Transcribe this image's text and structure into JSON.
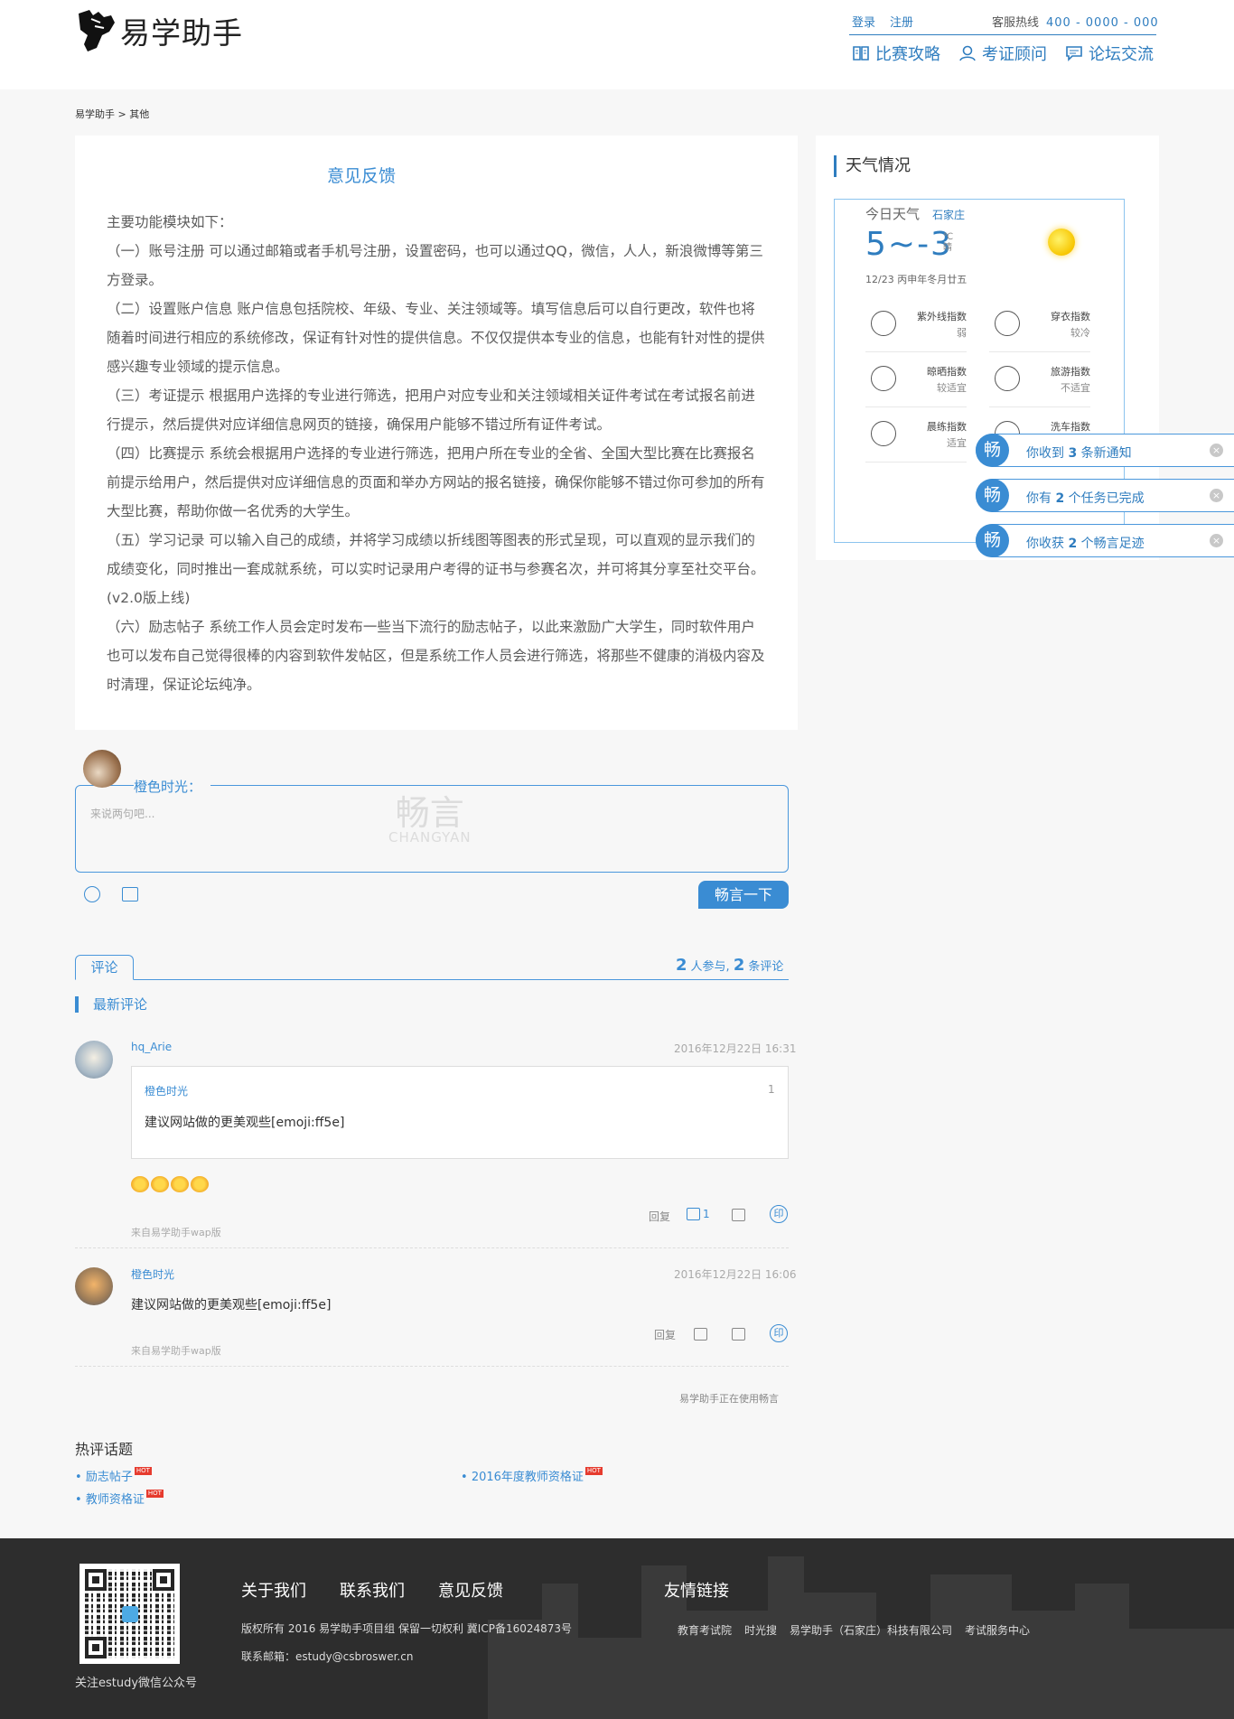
{
  "header": {
    "logo_text": "易学助手",
    "login": "登录",
    "register": "注册",
    "hotline_label": "客服热线",
    "hotline_number": "400 - 0000 - 000",
    "nav": [
      {
        "label": "比赛攻略",
        "icon": "book-icon"
      },
      {
        "label": "考证顾问",
        "icon": "user-icon"
      },
      {
        "label": "论坛交流",
        "icon": "chat-icon"
      }
    ]
  },
  "breadcrumb": {
    "home": "易学助手",
    "sep": ">",
    "current": "其他"
  },
  "article": {
    "title": "意见反馈",
    "paragraphs": [
      "主要功能模块如下：",
      "（一）账号注册 可以通过邮箱或者手机号注册，设置密码，也可以通过QQ，微信，人人，新浪微博等第三方登录。",
      "（二）设置账户信息 账户信息包括院校、年级、专业、关注领域等。填写信息后可以自行更改，软件也将随着时间进行相应的系统修改，保证有针对性的提供信息。不仅仅提供本专业的信息，也能有针对性的提供感兴趣专业领域的提示信息。",
      "（三）考证提示 根据用户选择的专业进行筛选，把用户对应专业和关注领域相关证件考试在考试报名前进行提示，然后提供对应详细信息网页的链接，确保用户能够不错过所有证件考试。",
      "（四）比赛提示 系统会根据用户选择的专业进行筛选，把用户所在专业的全省、全国大型比赛在比赛报名前提示给用户，然后提供对应详细信息的页面和举办方网站的报名链接，确保你能够不错过你可参加的所有大型比赛，帮助你做一名优秀的大学生。",
      "（五）学习记录 可以输入自己的成绩，并将学习成绩以折线图等图表的形式呈现，可以直观的显示我们的成绩变化，同时推出一套成就系统，可以实时记录用户考得的证书与参赛名次，并可将其分享至社交平台。(v2.0版上线)",
      "（六）励志帖子 系统工作人员会定时发布一些当下流行的励志帖子，以此来激励广大学生，同时软件用户也可以发布自己觉得很棒的内容到软件发帖区，但是系统工作人员会进行筛选，将那些不健康的消极内容及时清理，保证论坛纯净。"
    ]
  },
  "weather": {
    "title": "天气情况",
    "today_label": "今日天气",
    "city": "石家庄",
    "temp": "5~-3",
    "unit": "℃",
    "condition": "晴",
    "date": "12/23 丙申年冬月廿五",
    "indices": [
      {
        "name": "紫外线指数",
        "value": "弱",
        "icon": "umbrella-icon"
      },
      {
        "name": "穿衣指数",
        "value": "较冷",
        "icon": "shirt-icon"
      },
      {
        "name": "晾晒指数",
        "value": "较适宜",
        "icon": "hanger-icon"
      },
      {
        "name": "旅游指数",
        "value": "不适宜",
        "icon": "plane-icon"
      },
      {
        "name": "晨练指数",
        "value": "适宜",
        "icon": "ball-icon"
      },
      {
        "name": "洗车指数",
        "value": "",
        "icon": "car-icon"
      }
    ]
  },
  "toasts": [
    {
      "avatar": "畅",
      "pre": "你收到",
      "num": "3",
      "post": "条新通知"
    },
    {
      "avatar": "畅",
      "pre": "你有",
      "num": "2",
      "post": "个任务已完成"
    },
    {
      "avatar": "畅",
      "pre": "你收获",
      "num": "2",
      "post": "个畅言足迹"
    }
  ],
  "comment_box": {
    "user": "橙色时光：",
    "placeholder": "来说两句吧...",
    "watermark": "畅言",
    "watermark_sub": "CHANGYAN",
    "submit": "畅言一下"
  },
  "comments_section": {
    "tab": "评论",
    "participants": "2",
    "participants_label": "人参与,",
    "count": "2",
    "count_label": "条评论",
    "latest": "最新评论",
    "items": [
      {
        "user": "hq_Arie",
        "time": "2016年12月22日 16:31",
        "quote_user": "橙色时光",
        "quote_floor": "1",
        "quote_text": "建议网站做的更美观些[emoji:ff5e]",
        "reply": "回复",
        "likes": "1",
        "share": "印",
        "source": "来自易学助手wap版"
      },
      {
        "user": "橙色时光",
        "time": "2016年12月22日 16:06",
        "text": "建议网站做的更美观些[emoji:ff5e]",
        "reply": "回复",
        "share": "印",
        "source": "来自易学助手wap版"
      }
    ],
    "powered": "易学助手正在使用畅言"
  },
  "hot_topics": {
    "title": "热评话题",
    "badge": "HOT",
    "items": [
      "励志帖子",
      "2016年度教师资格证",
      "教师资格证"
    ]
  },
  "footer": {
    "qr_caption": "关注estudy微信公众号",
    "links": [
      "关于我们",
      "联系我们",
      "意见反馈"
    ],
    "copyright": "版权所有 2016 易学助手项目组 保留一切权利 冀ICP备16024873号",
    "email": "联系邮箱：estudy@csbroswer.cn",
    "friend_title": "友情链接",
    "friends": [
      "教育考试院",
      "时光搜",
      "易学助手（石家庄）科技有限公司",
      "考试服务中心"
    ]
  }
}
